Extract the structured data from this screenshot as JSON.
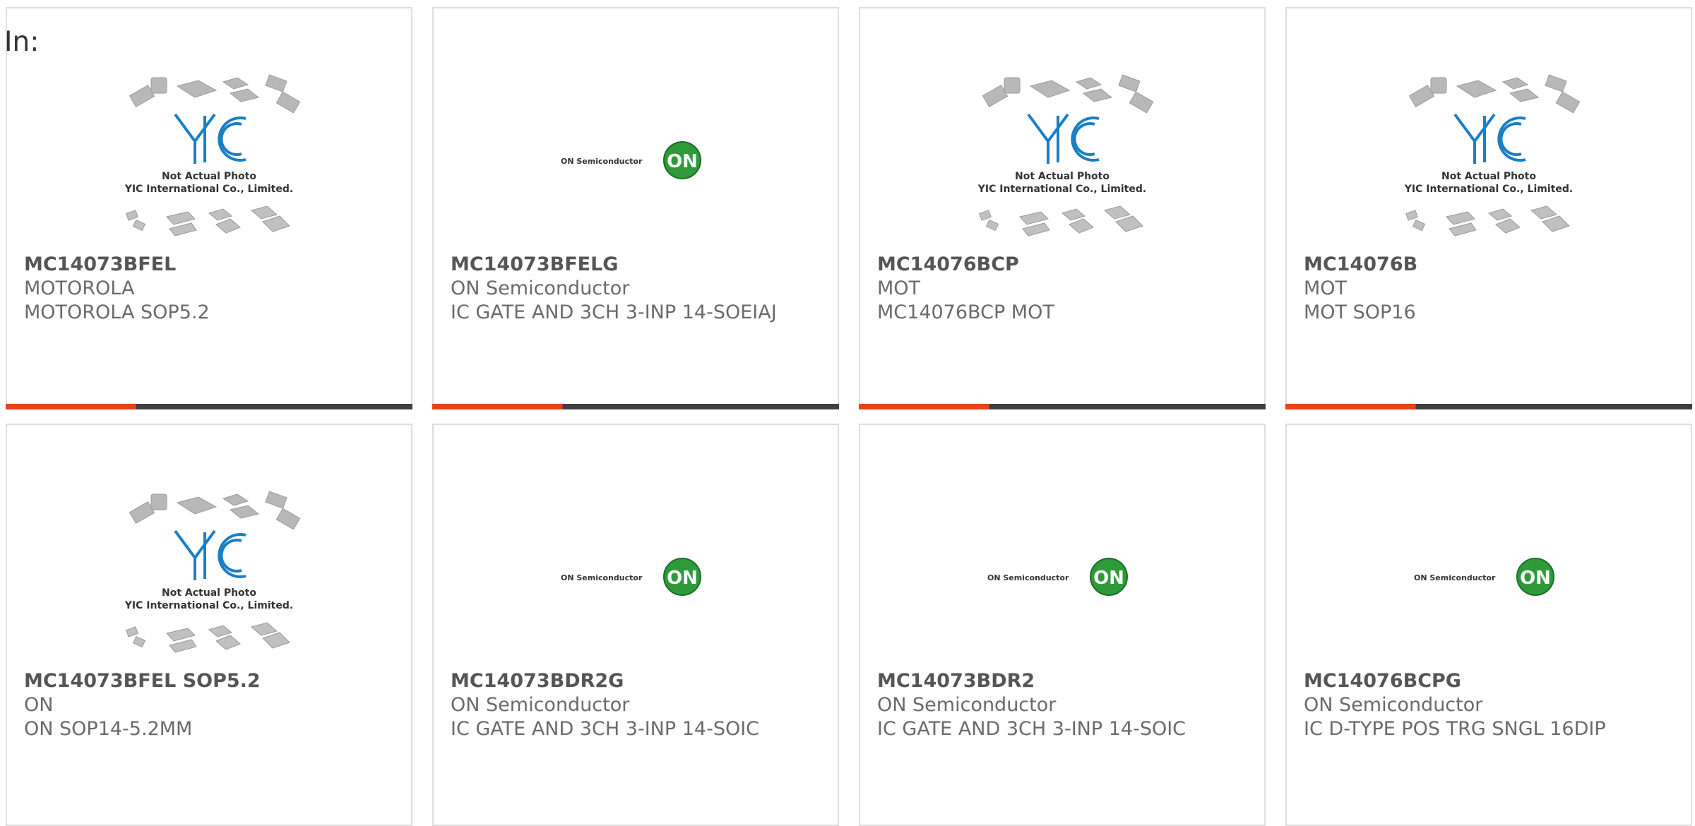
{
  "header": {
    "label": "In:"
  },
  "image_labels": {
    "yic_logo": "YIC",
    "yic_caption_1": "Not Actual Photo",
    "yic_caption_2": "YIC International Co., Limited.",
    "on_name": "ON Semiconductor",
    "on_mark": "ON"
  },
  "colors": {
    "accent": "#e8421a",
    "bar_dark": "#404040",
    "yic_blue": "#1a7fc4",
    "on_green": "#2e9a3a"
  },
  "products": [
    {
      "part": "MC14073BFEL",
      "maker": "MOTOROLA",
      "desc": "MOTOROLA SOP5.2",
      "image": "yic-placeholder",
      "bar": true
    },
    {
      "part": "MC14073BFELG",
      "maker": "ON Semiconductor",
      "desc": "IC GATE AND 3CH 3-INP 14-SOEIAJ",
      "image": "on-semiconductor-logo",
      "bar": true
    },
    {
      "part": "MC14076BCP",
      "maker": "MOT",
      "desc": "MC14076BCP MOT",
      "image": "yic-placeholder",
      "bar": true
    },
    {
      "part": "MC14076B",
      "maker": "MOT",
      "desc": "MOT SOP16",
      "image": "yic-placeholder",
      "bar": true
    },
    {
      "part": "MC14073BFEL SOP5.2",
      "maker": "ON",
      "desc": "ON SOP14-5.2MM",
      "image": "yic-placeholder",
      "bar": false
    },
    {
      "part": "MC14073BDR2G",
      "maker": "ON Semiconductor",
      "desc": "IC GATE AND 3CH 3-INP 14-SOIC",
      "image": "on-semiconductor-logo",
      "bar": false
    },
    {
      "part": "MC14073BDR2",
      "maker": "ON Semiconductor",
      "desc": "IC GATE AND 3CH 3-INP 14-SOIC",
      "image": "on-semiconductor-logo",
      "bar": false
    },
    {
      "part": "MC14076BCPG",
      "maker": "ON Semiconductor",
      "desc": "IC D-TYPE POS TRG SNGL 16DIP",
      "image": "on-semiconductor-logo",
      "bar": false
    }
  ]
}
